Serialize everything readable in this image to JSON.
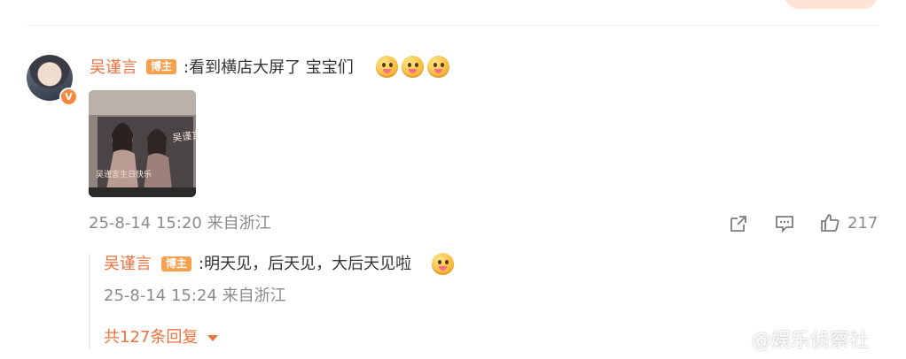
{
  "comment": {
    "username": "吴谨言",
    "tag": "博主",
    "text": ":看到横店大屏了 宝宝们",
    "emojis": [
      "grinning-face-icon",
      "grinning-face-icon",
      "grinning-face-icon"
    ],
    "timestamp": "25-8-14 15:20 来自浙江",
    "likes": "217",
    "image_caption": "吴谨言生日快乐",
    "image_caption_2": "吴谨言生日快乐"
  },
  "reply": {
    "username": "吴谨言",
    "tag": "博主",
    "text": ":明天见，后天见，大后天见啦",
    "timestamp": "25-8-14 15:24 来自浙江"
  },
  "more_replies": "共127条回复",
  "watermark": "@娱乐侦察社",
  "colors": {
    "accent": "#eb7340",
    "tag_bg": "#f7a04e",
    "meta_text": "#8b8b8b"
  }
}
